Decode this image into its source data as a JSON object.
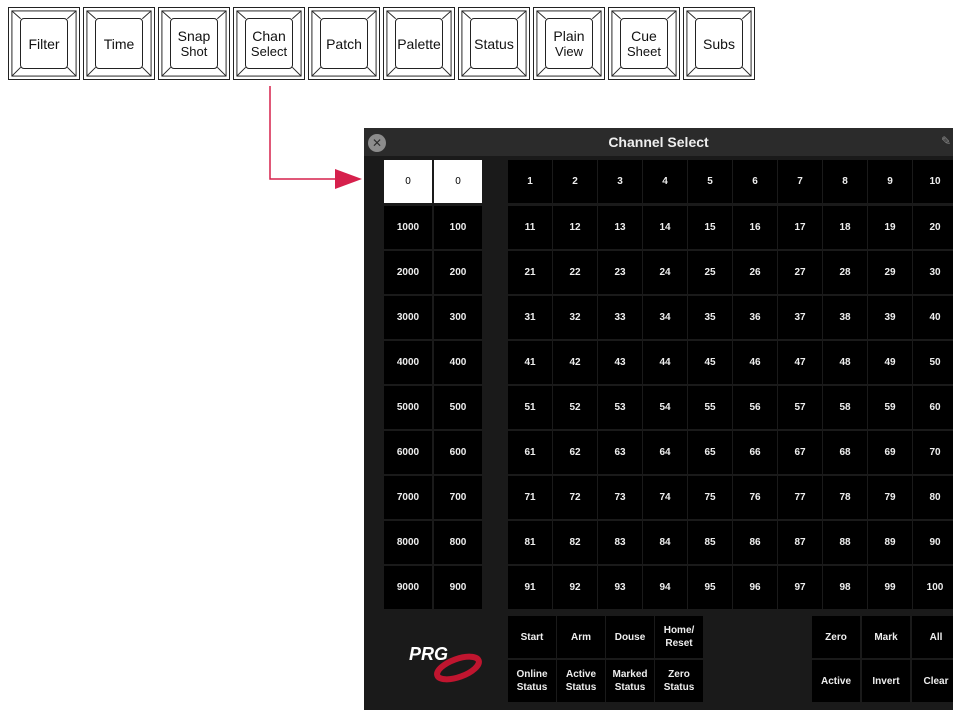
{
  "toolbar": {
    "keys": [
      {
        "line1": "Filter",
        "line2": ""
      },
      {
        "line1": "Time",
        "line2": ""
      },
      {
        "line1": "Snap",
        "line2": "Shot"
      },
      {
        "line1": "Chan",
        "line2": "Select"
      },
      {
        "line1": "Patch",
        "line2": ""
      },
      {
        "line1": "Palette",
        "line2": ""
      },
      {
        "line1": "Status",
        "line2": ""
      },
      {
        "line1": "Plain",
        "line2": "View"
      },
      {
        "line1": "Cue",
        "line2": "Sheet"
      },
      {
        "line1": "Subs",
        "line2": ""
      }
    ]
  },
  "window": {
    "title": "Channel Select",
    "close_icon": "close-icon",
    "pin_icon": "pin-icon"
  },
  "thousands": [
    "0",
    "1000",
    "2000",
    "3000",
    "4000",
    "5000",
    "6000",
    "7000",
    "8000",
    "9000"
  ],
  "hundreds": [
    "0",
    "100",
    "200",
    "300",
    "400",
    "500",
    "600",
    "700",
    "800",
    "900"
  ],
  "channels": [
    "1",
    "2",
    "3",
    "4",
    "5",
    "6",
    "7",
    "8",
    "9",
    "10",
    "11",
    "12",
    "13",
    "14",
    "15",
    "16",
    "17",
    "18",
    "19",
    "20",
    "21",
    "22",
    "23",
    "24",
    "25",
    "26",
    "27",
    "28",
    "29",
    "30",
    "31",
    "32",
    "33",
    "34",
    "35",
    "36",
    "37",
    "38",
    "39",
    "40",
    "41",
    "42",
    "43",
    "44",
    "45",
    "46",
    "47",
    "48",
    "49",
    "50",
    "51",
    "52",
    "53",
    "54",
    "55",
    "56",
    "57",
    "58",
    "59",
    "60",
    "61",
    "62",
    "63",
    "64",
    "65",
    "66",
    "67",
    "68",
    "69",
    "70",
    "71",
    "72",
    "73",
    "74",
    "75",
    "76",
    "77",
    "78",
    "79",
    "80",
    "81",
    "82",
    "83",
    "84",
    "85",
    "86",
    "87",
    "88",
    "89",
    "90",
    "91",
    "92",
    "93",
    "94",
    "95",
    "96",
    "97",
    "98",
    "99",
    "100"
  ],
  "commands_left": [
    {
      "line1": "Start",
      "line2": ""
    },
    {
      "line1": "Arm",
      "line2": ""
    },
    {
      "line1": "Douse",
      "line2": ""
    },
    {
      "line1": "Home/",
      "line2": "Reset"
    },
    {
      "line1": "Online",
      "line2": "Status"
    },
    {
      "line1": "Active",
      "line2": "Status"
    },
    {
      "line1": "Marked",
      "line2": "Status"
    },
    {
      "line1": "Zero",
      "line2": "Status"
    }
  ],
  "commands_right": [
    {
      "line1": "Zero",
      "line2": ""
    },
    {
      "line1": "Mark",
      "line2": ""
    },
    {
      "line1": "All",
      "line2": ""
    },
    {
      "line1": "Active",
      "line2": ""
    },
    {
      "line1": "Invert",
      "line2": ""
    },
    {
      "line1": "Clear",
      "line2": ""
    }
  ],
  "logo": {
    "text": "PRG"
  },
  "colors": {
    "panel_bg": "#1a1a1a",
    "cell_bg": "#000000",
    "selected_bg": "#ffffff",
    "arrow": "#d6204c",
    "logo_red": "#c0152f"
  }
}
